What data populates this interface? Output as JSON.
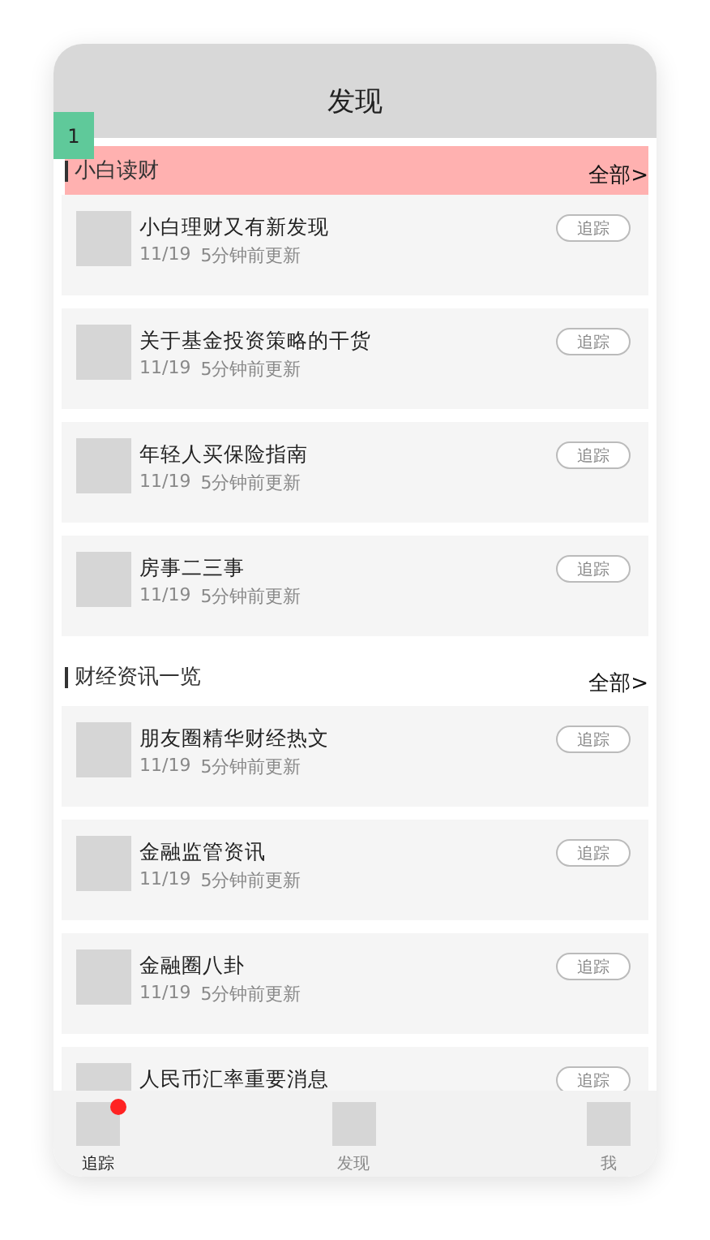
{
  "header": {
    "title": "发现"
  },
  "badge": "1",
  "sections": [
    {
      "title": "小白读财",
      "more": "全部>",
      "highlighted": true,
      "items": [
        {
          "title": "小白理财又有新发现",
          "date": "11/19",
          "updated": "5分钟前更新",
          "button": "追踪"
        },
        {
          "title": "关于基金投资策略的干货",
          "date": "11/19",
          "updated": "5分钟前更新",
          "button": "追踪"
        },
        {
          "title": "年轻人买保险指南",
          "date": "11/19",
          "updated": "5分钟前更新",
          "button": "追踪"
        },
        {
          "title": "房事二三事",
          "date": "11/19",
          "updated": "5分钟前更新",
          "button": "追踪"
        }
      ]
    },
    {
      "title": "财经资讯一览",
      "more": "全部>",
      "highlighted": false,
      "items": [
        {
          "title": "朋友圈精华财经热文",
          "date": "11/19",
          "updated": "5分钟前更新",
          "button": "追踪"
        },
        {
          "title": "金融监管资讯",
          "date": "11/19",
          "updated": "5分钟前更新",
          "button": "追踪"
        },
        {
          "title": "金融圈八卦",
          "date": "11/19",
          "updated": "5分钟前更新",
          "button": "追踪"
        },
        {
          "title": "人民币汇率重要消息",
          "button": "追踪"
        }
      ]
    }
  ],
  "tabs": [
    {
      "label": "追踪",
      "selected": true,
      "dot": true
    },
    {
      "label": "发现",
      "selected": false,
      "dot": false
    },
    {
      "label": "我",
      "selected": false,
      "dot": false
    }
  ]
}
